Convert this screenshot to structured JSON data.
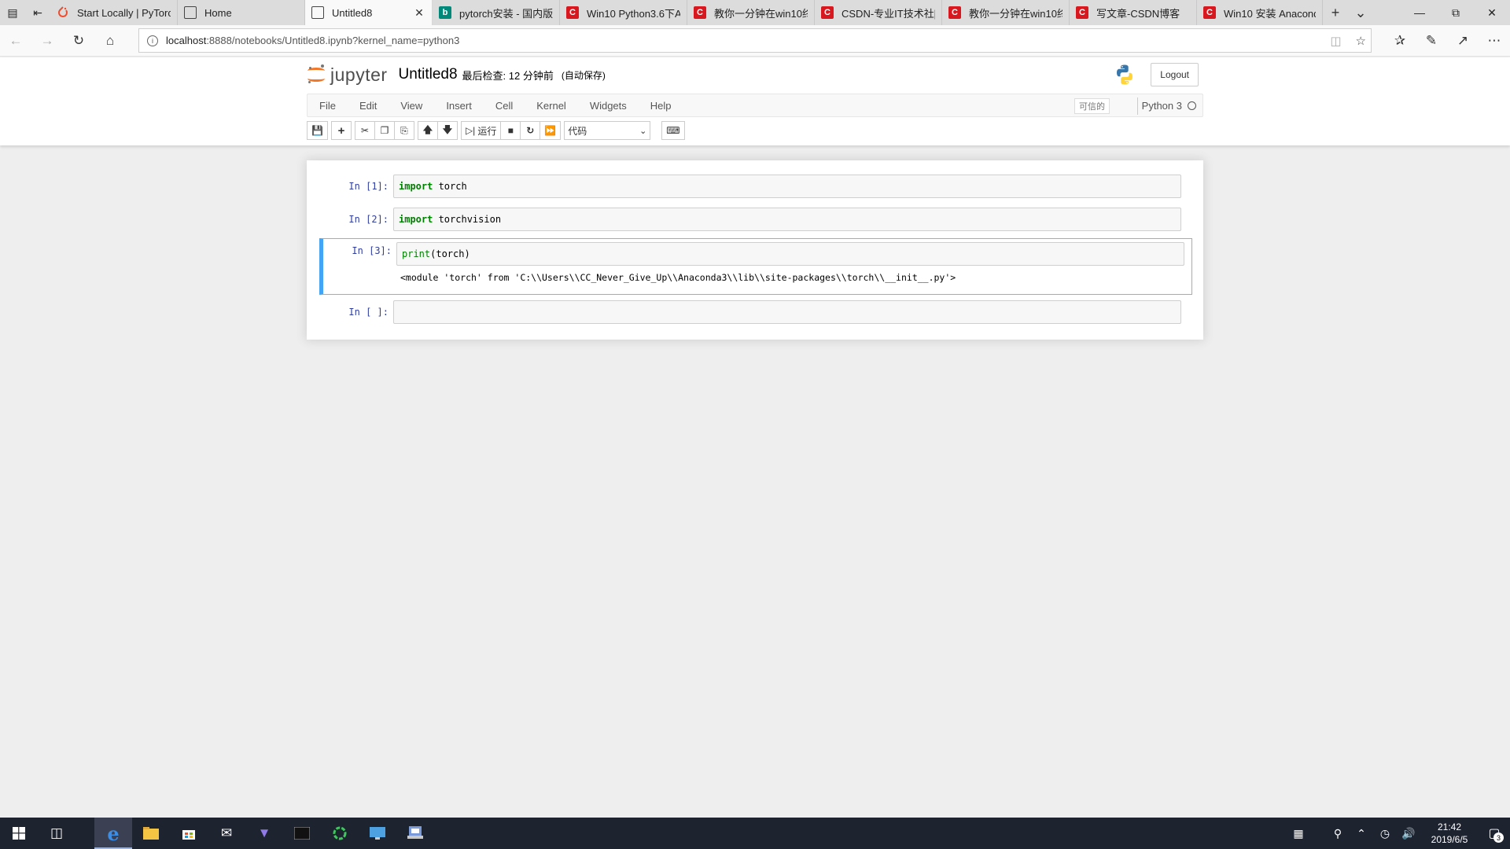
{
  "browser": {
    "tabs": [
      {
        "title": "Start Locally | PyTorc",
        "icon": "pytorch-icon",
        "active": false
      },
      {
        "title": "Home",
        "icon": "page-icon",
        "active": false
      },
      {
        "title": "Untitled8",
        "icon": "page-icon",
        "active": true
      },
      {
        "title": "pytorch安装 - 国内版",
        "icon": "bing-icon",
        "active": false
      },
      {
        "title": "Win10 Python3.6下A",
        "icon": "csdn-icon",
        "active": false
      },
      {
        "title": "教你一分钟在win10终",
        "icon": "csdn-icon",
        "active": false
      },
      {
        "title": "CSDN-专业IT技术社[",
        "icon": "csdn-icon",
        "active": false
      },
      {
        "title": "教你一分钟在win10终",
        "icon": "csdn-icon",
        "active": false
      },
      {
        "title": "写文章-CSDN博客",
        "icon": "csdn-icon",
        "active": false
      },
      {
        "title": "Win10 安装 Anacond",
        "icon": "csdn-icon",
        "active": false
      }
    ],
    "url_host": "localhost",
    "url_rest": ":8888/notebooks/Untitled8.ipynb?kernel_name=python3"
  },
  "jupyter": {
    "logo_text": "jupyter",
    "notebook_name": "Untitled8",
    "checkpoint": "最后检查: 12 分钟前",
    "autosave": "(自动保存)",
    "logout": "Logout",
    "menu": [
      "File",
      "Edit",
      "View",
      "Insert",
      "Cell",
      "Kernel",
      "Widgets",
      "Help"
    ],
    "trusted": "可信的",
    "kernel": "Python 3",
    "run_label": "运行",
    "cell_type": "代码"
  },
  "cells": [
    {
      "prompt": "In  [1]:",
      "kw": "import",
      "code": " torch"
    },
    {
      "prompt": "In  [2]:",
      "kw": "import",
      "code": " torchvision"
    },
    {
      "prompt": "In  [3]:",
      "fn": "print",
      "code": "(torch)",
      "output": "<module 'torch' from 'C:\\\\Users\\\\CC_Never_Give_Up\\\\Anaconda3\\\\lib\\\\site-packages\\\\torch\\\\__init__.py'>"
    },
    {
      "prompt": "In  [ ]:",
      "code": ""
    }
  ],
  "taskbar": {
    "time": "21:42",
    "date": "2019/6/5",
    "notifications": "3"
  },
  "colors": {
    "jupyter_orange": "#f37726",
    "selected_cell": "#42a5f5",
    "keyword_green": "#008000",
    "prompt_blue": "#303f9f",
    "csdn_red": "#d8181e"
  }
}
